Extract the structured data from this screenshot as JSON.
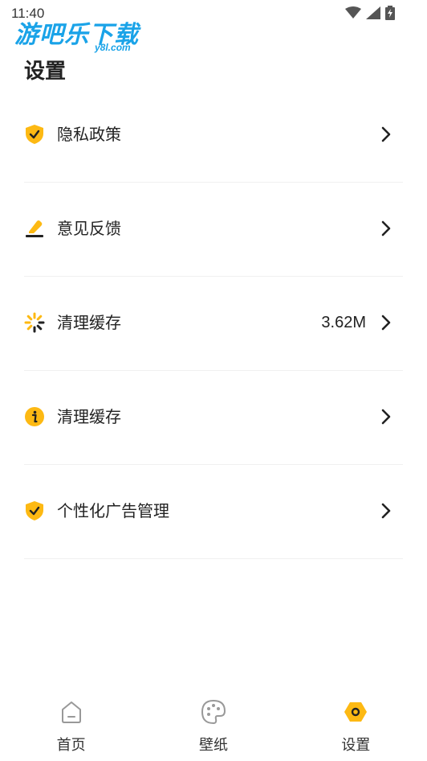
{
  "status_bar": {
    "time": "11:40"
  },
  "watermark": {
    "title": "游吧乐下载",
    "subtitle": "y8l.com"
  },
  "page": {
    "title": "设置"
  },
  "colors": {
    "accent": "#FDB913",
    "text": "#222222",
    "divider": "#F0F0F0",
    "icon_dark": "#222222"
  },
  "menu": {
    "items": [
      {
        "label": "隐私政策",
        "value": "",
        "icon": "shield-check-icon"
      },
      {
        "label": "意见反馈",
        "value": "",
        "icon": "pencil-feedback-icon"
      },
      {
        "label": "清理缓存",
        "value": "3.62M",
        "icon": "loading-spinner-icon"
      },
      {
        "label": "清理缓存",
        "value": "",
        "icon": "info-icon"
      },
      {
        "label": "个性化广告管理",
        "value": "",
        "icon": "shield-check-icon"
      }
    ]
  },
  "tabs": [
    {
      "label": "首页",
      "icon": "home-icon",
      "active": false
    },
    {
      "label": "壁纸",
      "icon": "palette-icon",
      "active": false
    },
    {
      "label": "设置",
      "icon": "settings-icon",
      "active": true
    }
  ]
}
